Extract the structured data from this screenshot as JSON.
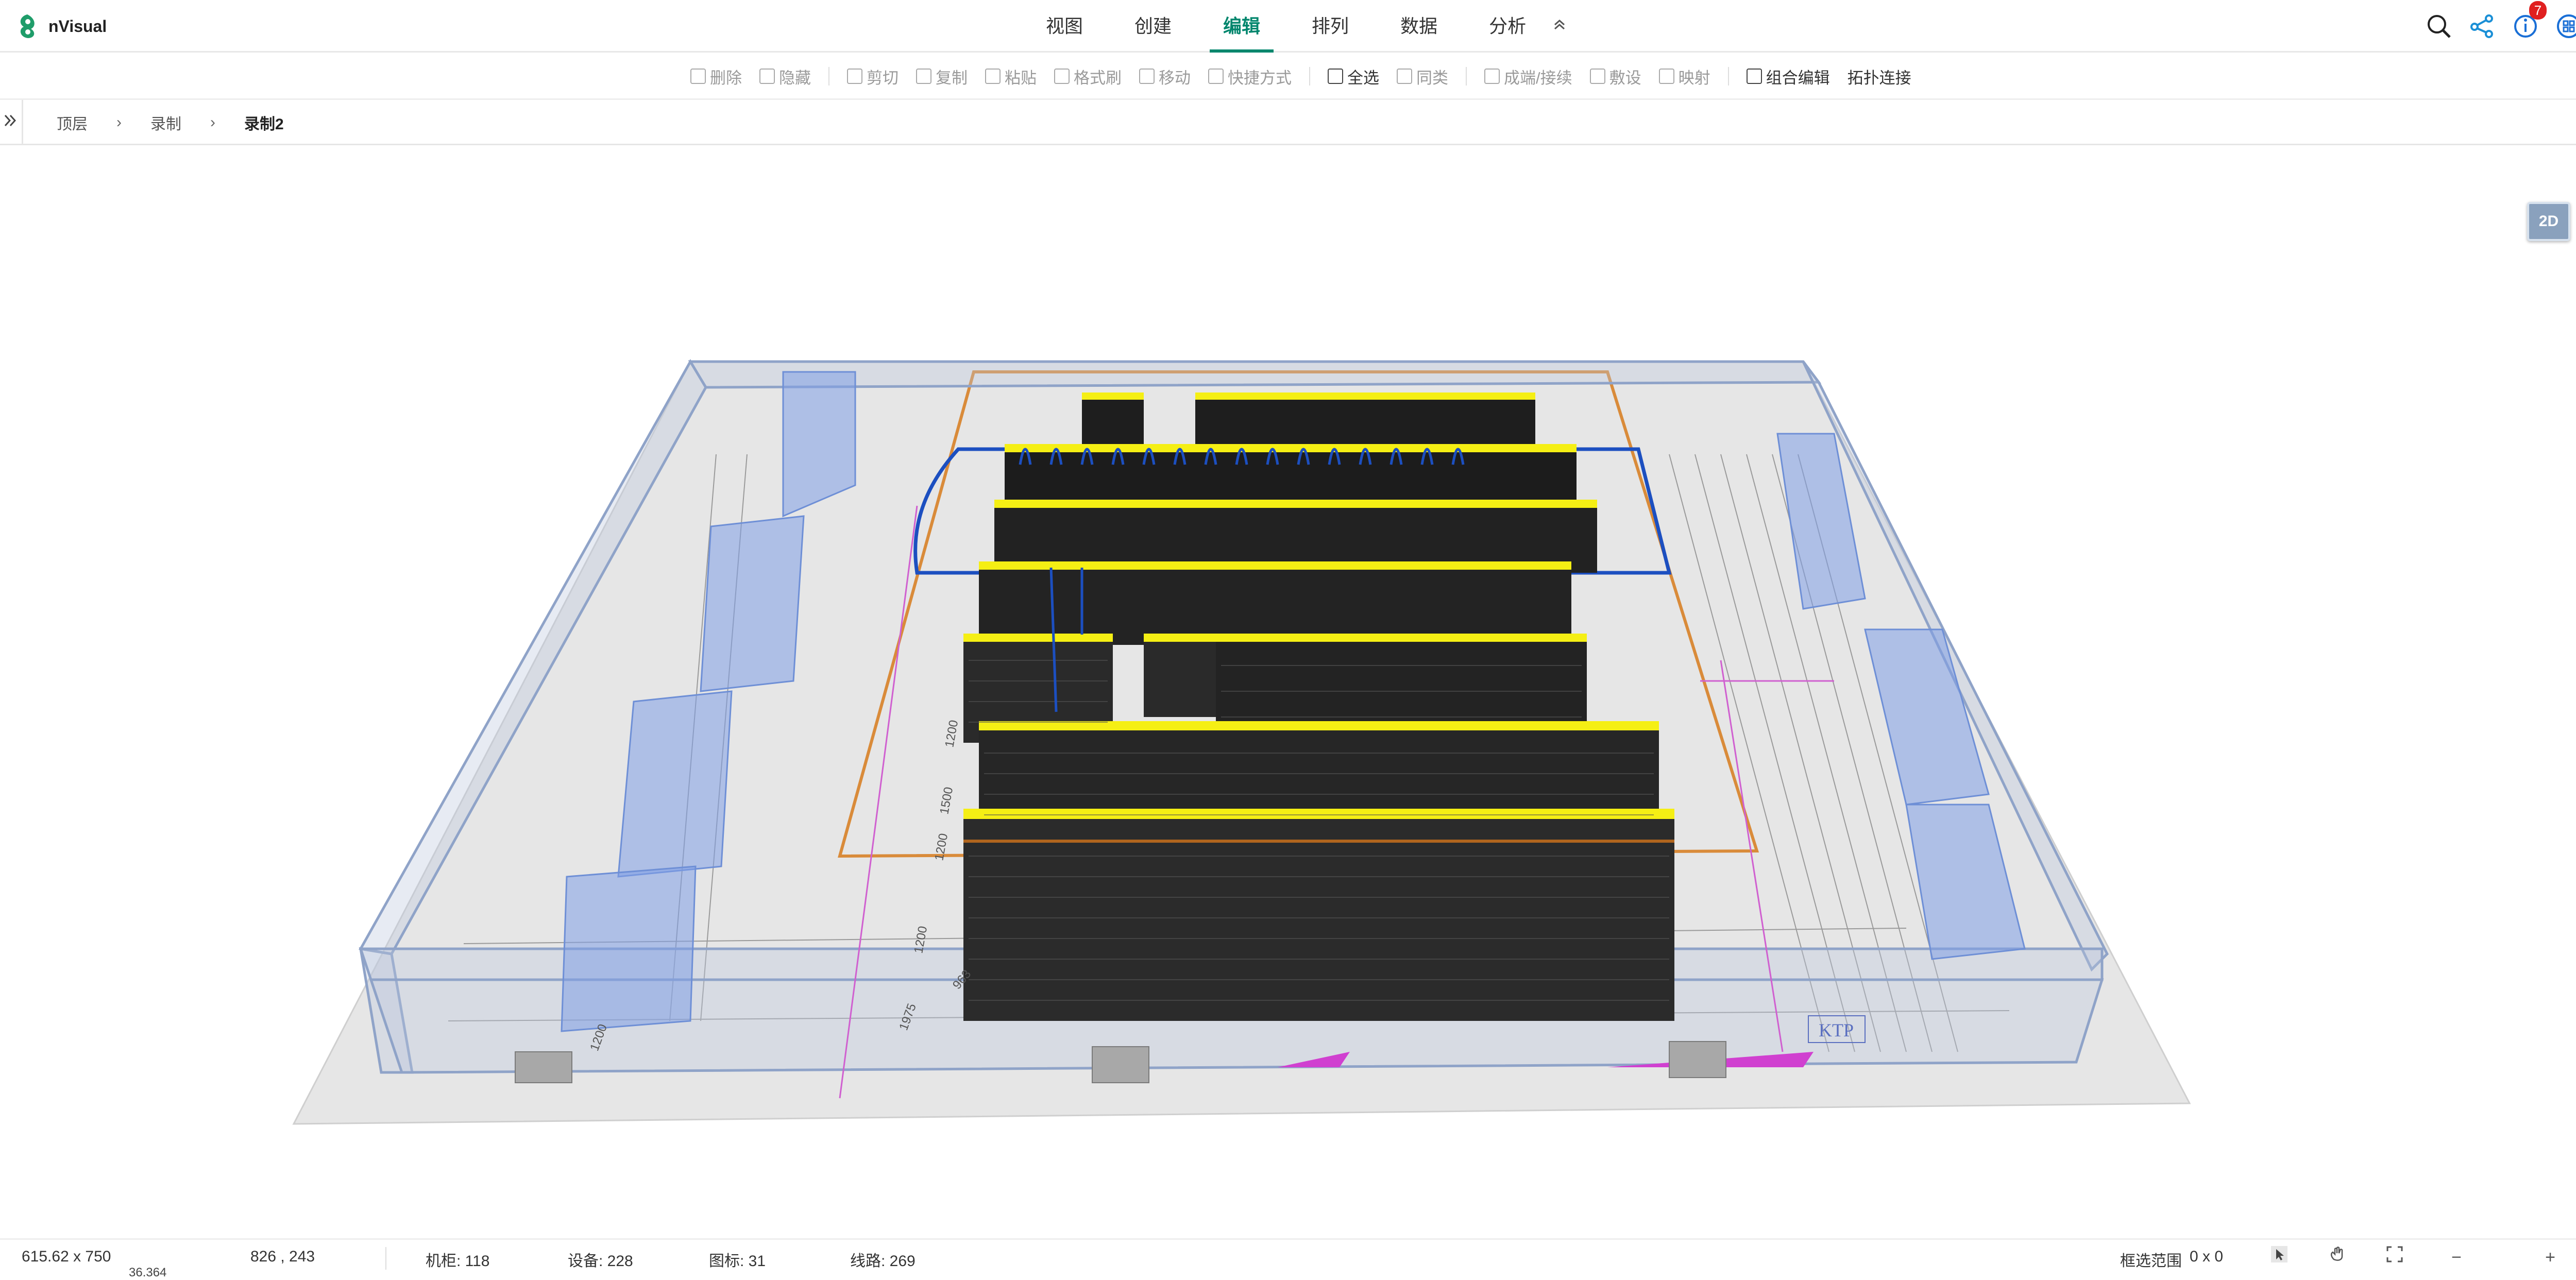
{
  "app": {
    "name": "nVisual"
  },
  "menu": {
    "items": [
      {
        "label": "视图",
        "active": false
      },
      {
        "label": "创建",
        "active": false
      },
      {
        "label": "编辑",
        "active": true
      },
      {
        "label": "排列",
        "active": false
      },
      {
        "label": "数据",
        "active": false
      },
      {
        "label": "分析",
        "active": false
      }
    ],
    "collapse_icon": "chevron-double-up-icon"
  },
  "top_icons": {
    "notification_count": "7"
  },
  "toolbar": {
    "items": [
      {
        "label": "删除",
        "enabled": false,
        "icon": "trash-icon"
      },
      {
        "label": "隐藏",
        "enabled": false,
        "icon": "eye-icon"
      },
      {
        "label": "剪切",
        "enabled": false,
        "icon": "scissors-icon"
      },
      {
        "label": "复制",
        "enabled": false,
        "icon": "copy-icon"
      },
      {
        "label": "粘贴",
        "enabled": false,
        "icon": "paste-icon"
      },
      {
        "label": "格式刷",
        "enabled": false,
        "icon": "brush-icon"
      },
      {
        "label": "移动",
        "enabled": false,
        "icon": "move-icon"
      },
      {
        "label": "快捷方式",
        "enabled": false,
        "icon": "shortcut-icon"
      },
      {
        "label": "全选",
        "enabled": true,
        "icon": "select-all-icon"
      },
      {
        "label": "同类",
        "enabled": false,
        "icon": "same-type-icon"
      },
      {
        "label": "成端/接续",
        "enabled": false,
        "icon": "splice-icon"
      },
      {
        "label": "敷设",
        "enabled": false,
        "icon": "lay-cable-icon"
      },
      {
        "label": "映射",
        "enabled": false,
        "icon": "mapping-icon"
      },
      {
        "label": "组合编辑",
        "enabled": true,
        "icon": "group-edit-icon"
      },
      {
        "label": "拓扑连接",
        "enabled": true,
        "icon": ""
      }
    ]
  },
  "breadcrumb": {
    "items": [
      "顶层",
      "录制",
      "录制2"
    ],
    "separator": "›"
  },
  "view": {
    "mode_button": "2D",
    "help": "?"
  },
  "scene_labels": {
    "ktp": "KTP",
    "dims": [
      "1200",
      "1500",
      "1200",
      "1200",
      "1975",
      "1200",
      "963"
    ]
  },
  "status": {
    "canvas_size": "615.62 x 750",
    "sub_value": "36.364",
    "cursor": "826 , 243",
    "cabinets": "机柜: 118",
    "devices": "设备: 228",
    "icons": "图标: 31",
    "lines": "线路: 269",
    "selection_label": "框选范围",
    "selection_value": "0 x 0"
  },
  "colors": {
    "accent": "#00866d",
    "rack_top": "#f5ef14",
    "rack_body": "#1e1e1e",
    "glass": "#9eb3e8",
    "outline": "#1c4fc0",
    "guide_orange": "#d98b3a",
    "badge": "#e02020"
  }
}
